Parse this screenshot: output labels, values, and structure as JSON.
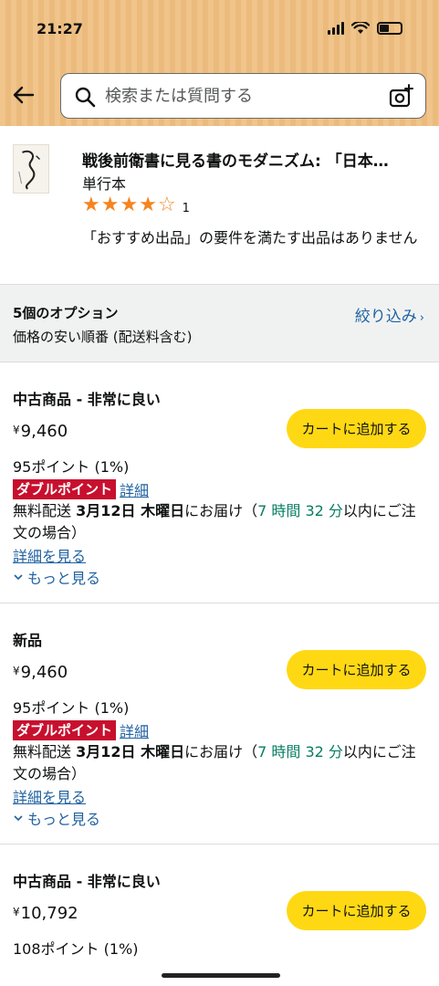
{
  "status": {
    "time": "21:27"
  },
  "search": {
    "placeholder": "検索または質問する"
  },
  "product": {
    "title": "戦後前衛書に見る書のモダニズム: 「日本…",
    "format": "単行本",
    "rating": 4,
    "rating_count": "1",
    "note": "「おすすめ出品」の要件を満たす出品はありません"
  },
  "options": {
    "count_label": "5個のオプション",
    "sort_label": "価格の安い順番 (配送料含む)",
    "filter_label": "絞り込み"
  },
  "offers": [
    {
      "condition": "中古商品 - 非常に良い",
      "currency": "¥",
      "price": "9,460",
      "cart_label": "カートに追加する",
      "points": "95ポイント (1%)",
      "double_badge": "ダブルポイント",
      "double_link": "詳細",
      "delivery_prefix": "無料配送 ",
      "delivery_date": "3月12日 木曜日",
      "delivery_mid": "にお届け（",
      "delivery_time": "7 時間 32 分",
      "delivery_suffix": "以内にご注文の場合）",
      "details_link": "詳細を見る",
      "more_label": "もっと見る"
    },
    {
      "condition": "新品",
      "currency": "¥",
      "price": "9,460",
      "cart_label": "カートに追加する",
      "points": "95ポイント (1%)",
      "double_badge": "ダブルポイント",
      "double_link": "詳細",
      "delivery_prefix": "無料配送 ",
      "delivery_date": "3月12日 木曜日",
      "delivery_mid": "にお届け（",
      "delivery_time": "7 時間 32 分",
      "delivery_suffix": "以内にご注文の場合）",
      "details_link": "詳細を見る",
      "more_label": "もっと見る"
    },
    {
      "condition": "中古商品 - 非常に良い",
      "currency": "¥",
      "price": "10,792",
      "cart_label": "カートに追加する",
      "points": "108ポイント (1%)"
    }
  ],
  "colors": {
    "header_bg": "#f0c48a",
    "cart_button": "#ffd814",
    "link": "#2162a1",
    "badge": "#c7102e",
    "star": "#f5841f",
    "delivery_time": "#067d62"
  }
}
